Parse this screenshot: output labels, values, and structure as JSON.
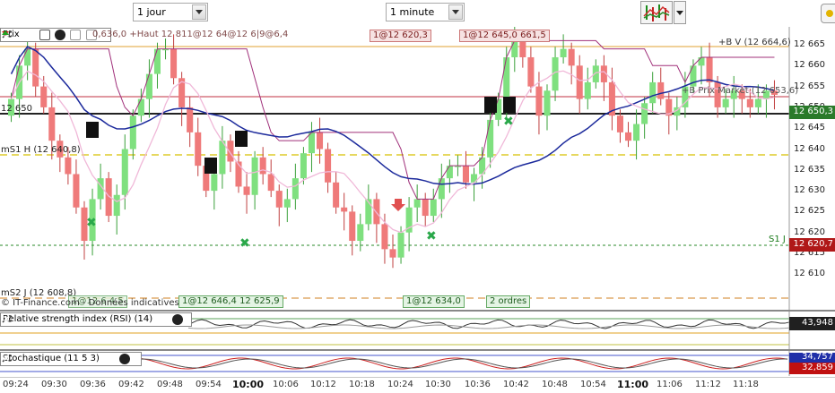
{
  "toolbar": {
    "period_combo": "1 jour",
    "interval_combo": "1 minute"
  },
  "price_pane": {
    "label": "Prix",
    "legend_overlap_text": "0,636,0 +Haut 12 811@12 64@12 6|9@6,4",
    "tick_labels": [
      "12 665",
      "12 660",
      "12 655",
      "12 650",
      "12 645",
      "12 640",
      "12 635",
      "12 630",
      "12 625",
      "12 620",
      "12 615",
      "12 610"
    ],
    "current_price_box": "12 650,3",
    "s1_box": "12 620,7",
    "level_labels": {
      "b_v": "+B V (12 664,6)",
      "prix_market": "+B Prix Market (12 653,6)",
      "s1_right": "S1 J",
      "level_12650": "12 650",
      "ms1_h": "mS1 H (12 640,8)",
      "ms2_j": "mS2 J (12 608,8)"
    },
    "top_tags": [
      "1@12 620,3",
      "1@12 645,0 661,5"
    ],
    "bottom_tags": [
      "1@12 646,4 12 625,9",
      "1@12 634,0",
      "2 ordres"
    ],
    "footer_text": "© IT-Finance.com - Données indicatives",
    "footer_overlap_tag": "1@12 6 4,5"
  },
  "rsi_pane": {
    "label": "Relative strength index (RSI) (14)",
    "value_box": "43,948"
  },
  "stoch_pane": {
    "label": "Stochastique (11 5 3)",
    "value_box_top": "34,757",
    "value_box_bottom": "32,859"
  },
  "time_axis": [
    "09:24",
    "09:30",
    "09:36",
    "09:42",
    "09:48",
    "09:54",
    "10:00",
    "10:06",
    "10:12",
    "10:18",
    "10:24",
    "10:30",
    "10:36",
    "10:42",
    "10:48",
    "10:54",
    "11:00",
    "11:06",
    "11:12",
    "11:18"
  ],
  "colors": {
    "bull_candle": "#7fe07f",
    "bear_candle": "#ef7a7a",
    "ma_slow": "#1c2a9c",
    "ma_fast": "#f0b8d8",
    "step_line": "#a0307a",
    "current_price_box": "#2a7a2a",
    "s1_box": "#b01818",
    "rsi_box": "#202020",
    "stoch_box_top": "#1f2fa8",
    "stoch_box_bottom": "#c01010"
  }
}
